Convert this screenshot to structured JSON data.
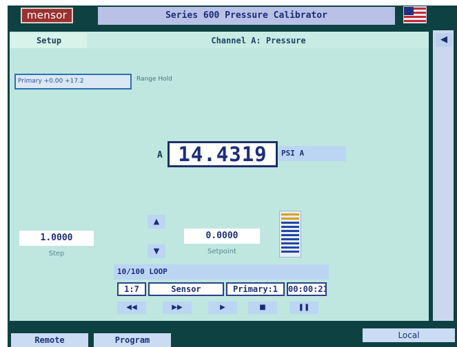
{
  "app": {
    "logo": "mensor",
    "title": "Series 600 Pressure Calibrator",
    "flag_icon": "us-flag-icon"
  },
  "header": {
    "setup_tab": "Setup",
    "channel_title": "Channel A: Pressure",
    "side_arrow": "◀"
  },
  "range": {
    "primary_range": "Primary +0.00 +17.2",
    "range_hold": "Range Hold"
  },
  "reading": {
    "channel": "A",
    "value": "14.4319",
    "unit": "PSI A"
  },
  "step": {
    "value": "1.0000",
    "label": "Step"
  },
  "setpoint": {
    "value": "0.0000",
    "label": "Setpoint",
    "up_icon": "▲",
    "down_icon": "▼"
  },
  "loop": {
    "title": "10/100 LOOP",
    "cells": [
      "1:7",
      "Sensor",
      "Primary:1",
      "00:00:21"
    ],
    "controls": [
      {
        "icon": "rewind-icon",
        "glyph": "◀◀"
      },
      {
        "icon": "fast-forward-icon",
        "glyph": "▶▶"
      },
      {
        "icon": "play-icon",
        "glyph": "▶"
      },
      {
        "icon": "stop-icon",
        "glyph": "■"
      },
      {
        "icon": "pause-icon",
        "glyph": "❚❚"
      }
    ]
  },
  "footer": {
    "remote": "Remote",
    "program": "Program",
    "local": "Local"
  },
  "colors": {
    "frame": "#0e4142",
    "panel": "#bfe7e0",
    "accent": "#bcd5f2",
    "text": "#1c2f7a",
    "logo": "#9b3131"
  }
}
